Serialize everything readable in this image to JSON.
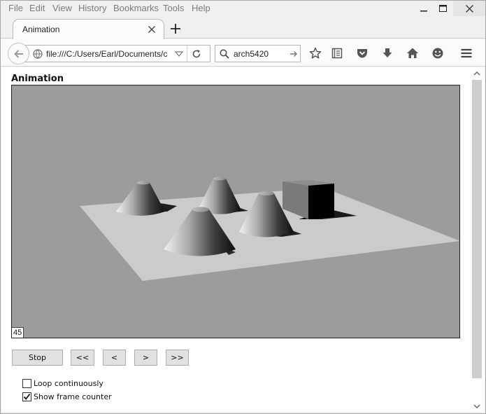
{
  "menu": {
    "items": [
      "File",
      "Edit",
      "View",
      "History",
      "Bookmarks",
      "Tools",
      "Help"
    ]
  },
  "tab": {
    "title": "Animation"
  },
  "nav": {
    "url": "file:///C:/Users/Earl/Documents/c",
    "search_value": "arch5420"
  },
  "page": {
    "title": "Animation",
    "frame_counter": "45",
    "buttons": {
      "stop": "Stop",
      "first": "<<",
      "prev": "<",
      "next": ">",
      "last": ">>"
    },
    "options": {
      "loop_label": "Loop continuously",
      "loop_checked": false,
      "counter_label": "Show frame counter",
      "counter_checked": true
    }
  },
  "colors": {
    "scene_background": "#9c9c9c",
    "floor": "#cbcbcb",
    "shadow": "#1a1a1a"
  },
  "icons": {
    "back": "back-arrow-icon",
    "info": "globe-icon",
    "reload": "reload-icon",
    "search": "search-icon",
    "go": "arrow-right-icon",
    "bookmark": "star-icon",
    "reader": "reading-list-icon",
    "pocket": "pocket-icon",
    "download": "download-icon",
    "home": "home-icon",
    "hello": "smiley-icon",
    "menu": "hamburger-menu-icon"
  }
}
